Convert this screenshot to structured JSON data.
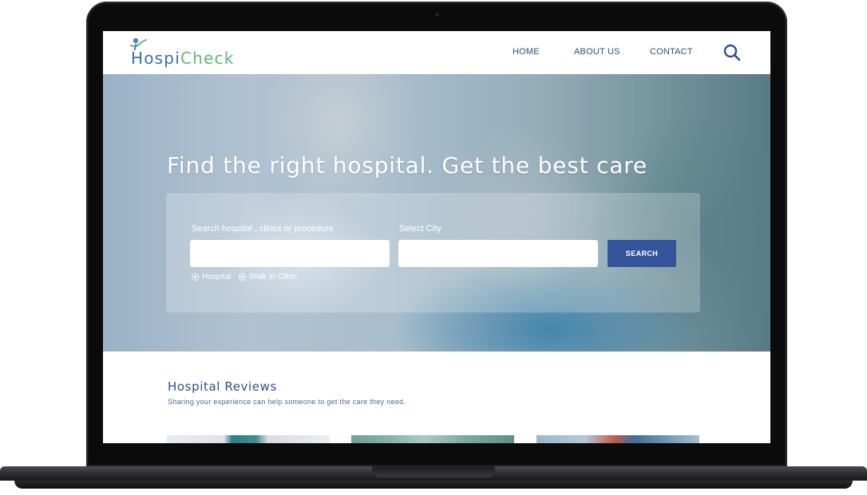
{
  "header": {
    "logo": {
      "part1": "Hospi",
      "part2": "Check"
    },
    "nav": {
      "home": "HOME",
      "about": "ABOUT US",
      "contact": "CONTACT"
    },
    "search_icon": "search-icon"
  },
  "hero": {
    "title": "Find the right hospital. Get the best care",
    "search": {
      "hospital_label": "Search hospital , clincs or procedure",
      "hospital_value": "",
      "city_label": "Select City",
      "city_value": "",
      "button_label": "SEARCH",
      "radio_options": [
        "Hospital",
        "Walk In Clinic"
      ]
    }
  },
  "reviews": {
    "title": "Hospital Reviews",
    "subtitle": "Sharing your experience can help someone to get the care they need."
  },
  "colors": {
    "brand_blue": "#3a6db0",
    "brand_green": "#5cb87a",
    "nav_text": "#2d4e86",
    "button": "#33549a"
  }
}
